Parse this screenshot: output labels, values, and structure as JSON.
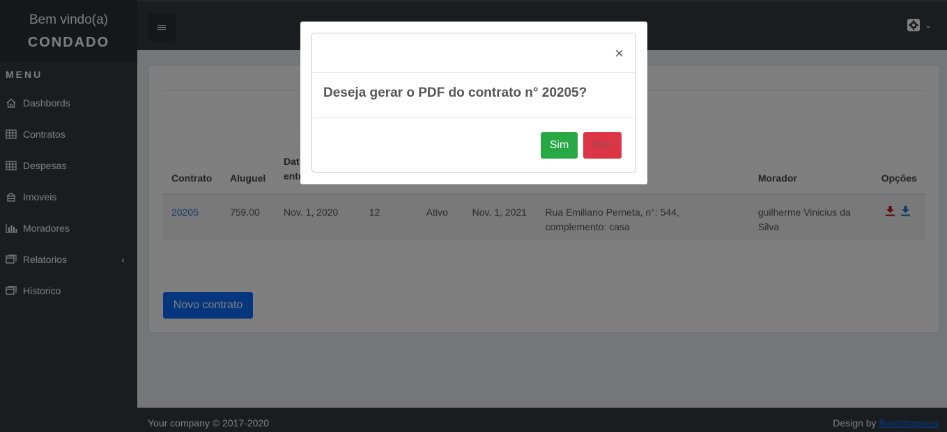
{
  "sidebar": {
    "welcome": "Bem vindo(a)",
    "company": "CONDADO",
    "menu_title": "MENU",
    "items": [
      {
        "label": "Dashbords",
        "icon": "home-icon"
      },
      {
        "label": "Contratos",
        "icon": "table-icon"
      },
      {
        "label": "Despesas",
        "icon": "table-icon"
      },
      {
        "label": "Imoveis",
        "icon": "building-icon"
      },
      {
        "label": "Moradores",
        "icon": "bar-chart-icon"
      },
      {
        "label": "Relatorios",
        "icon": "window-icon"
      },
      {
        "label": "Historico",
        "icon": "window-icon"
      }
    ]
  },
  "header": {
    "settings_icon": "gear-icon",
    "dropdown_icon": "chevron-down-icon"
  },
  "table": {
    "columns": [
      "Contrato",
      "Aluguel",
      "Dat\nentr",
      "",
      "",
      "",
      "",
      "Morador",
      "Opções"
    ],
    "rows": [
      {
        "contrato": "20205",
        "aluguel": "759.00",
        "data_entrada": "Nov. 1, 2020",
        "meses": "12",
        "status": "Ativo",
        "data_fim": "Nov. 1, 2021",
        "endereco": "Rua Emiliano Perneta, n°: 544, complemento: casa",
        "morador": "guilherme Vinicius da Silva"
      }
    ]
  },
  "actions": {
    "new_contract": "Novo contrato"
  },
  "footer": {
    "copyright": "Your company © 2017-2020",
    "design_by": "Design by",
    "design_link": "Bootstrapious"
  },
  "modal": {
    "close": "×",
    "message": "Deseja gerar o PDF do contrato n° 20205?",
    "yes": "Sim",
    "no": "Não"
  },
  "colors": {
    "sidebar": "#343a40",
    "primary": "#0d6efd",
    "success": "#28a745",
    "danger": "#dc3545",
    "download_red": "#c0101a",
    "download_blue": "#1a6fd0"
  }
}
